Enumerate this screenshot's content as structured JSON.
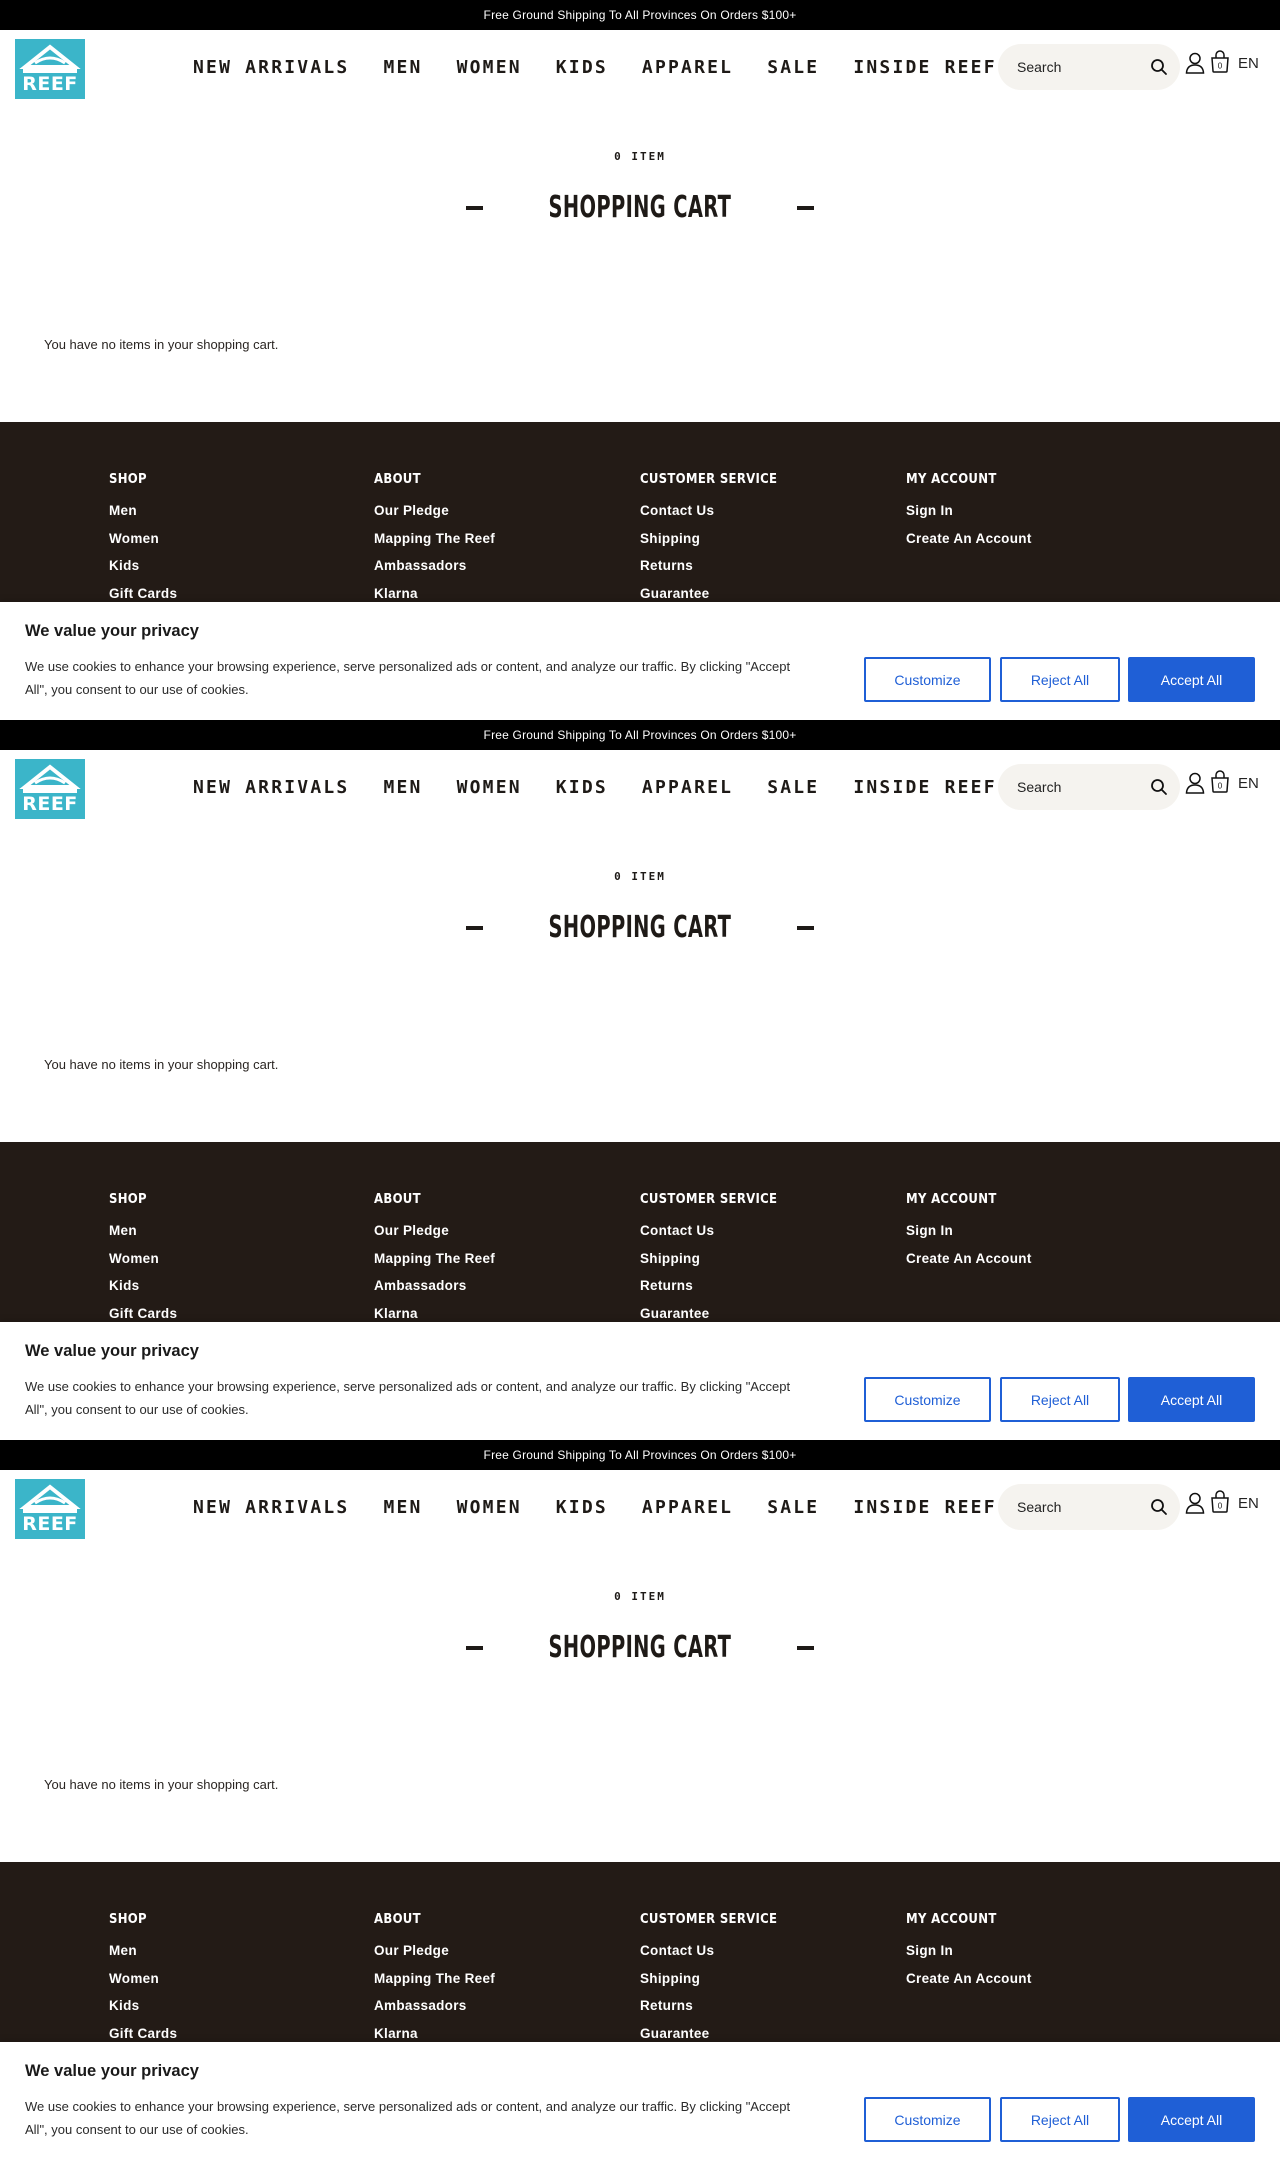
{
  "promo": {
    "text": "Free Ground Shipping To All Provinces On Orders $100+"
  },
  "header": {
    "logo_text": "REEF",
    "nav": [
      "NEW ARRIVALS",
      "MEN",
      "WOMEN",
      "KIDS",
      "APPAREL",
      "SALE",
      "INSIDE REEF"
    ],
    "search_placeholder": "Search",
    "cart_count": "0",
    "language": "EN"
  },
  "cart": {
    "item_count": "0 ITEM",
    "title": "SHOPPING CART",
    "empty_message": "You have no items in your shopping cart."
  },
  "footer": {
    "columns": [
      {
        "heading": "SHOP",
        "links": [
          "Men",
          "Women",
          "Kids",
          "Gift Cards"
        ]
      },
      {
        "heading": "ABOUT",
        "links": [
          "Our Pledge",
          "Mapping The Reef",
          "Ambassadors",
          "Klarna"
        ]
      },
      {
        "heading": "CUSTOMER SERVICE",
        "links": [
          "Contact Us",
          "Shipping",
          "Returns",
          "Guarantee"
        ]
      },
      {
        "heading": "MY ACCOUNT",
        "links": [
          "Sign In",
          "Create An Account"
        ]
      }
    ]
  },
  "cookie_banner": {
    "title": "We value your privacy",
    "text": "We use cookies to enhance your browsing experience, serve personalized ads or content, and analyze our traffic. By clicking \"Accept All\", you consent to our use of cookies.",
    "customize": "Customize",
    "reject": "Reject All",
    "accept": "Accept All"
  },
  "colors": {
    "accent": "#1f5fd6",
    "footer_bg": "#231b16",
    "logo_bg": "#3bb5c9"
  }
}
